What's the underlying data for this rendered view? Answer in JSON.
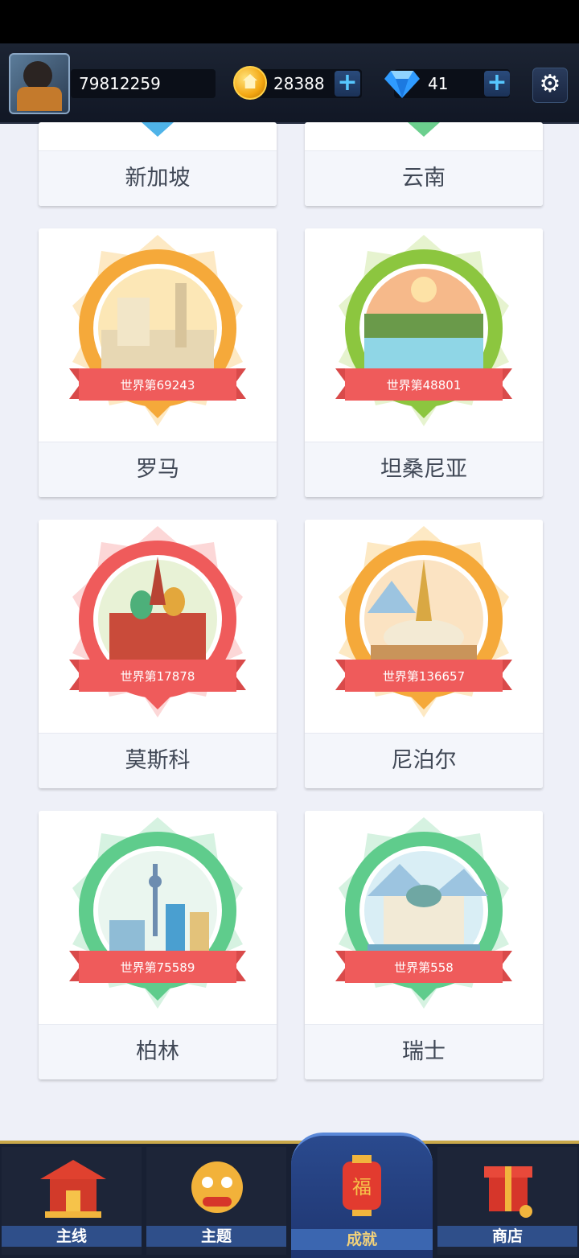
{
  "header": {
    "player_id": "79812259",
    "coins": "28388",
    "gems": "41",
    "coin_plus_label": "+",
    "gem_plus_label": "+",
    "settings_icon": "gear-icon"
  },
  "cities": [
    {
      "name": "新加坡",
      "color": "#4fb3e8"
    },
    {
      "name": "云南",
      "color": "#6ccf8e"
    },
    {
      "name": "罗马",
      "rank": "世界第69243",
      "color": "#f5a93a"
    },
    {
      "name": "坦桑尼亚",
      "rank": "世界第48801",
      "color": "#8cc63f"
    },
    {
      "name": "莫斯科",
      "rank": "世界第17878",
      "color": "#ef5b5b"
    },
    {
      "name": "尼泊尔",
      "rank": "世界第136657",
      "color": "#f5a93a"
    },
    {
      "name": "柏林",
      "rank": "世界第75589",
      "color": "#5fcc8c"
    },
    {
      "name": "瑞士",
      "rank": "世界第558",
      "color": "#5fcc8c"
    }
  ],
  "nav": {
    "tabs": [
      {
        "label": "主线",
        "icon": "pagoda-icon"
      },
      {
        "label": "主题",
        "icon": "lion-dance-icon"
      },
      {
        "label": "成就",
        "icon": "fu-lantern-icon",
        "active": true
      },
      {
        "label": "商店",
        "icon": "gift-shop-icon"
      }
    ]
  }
}
